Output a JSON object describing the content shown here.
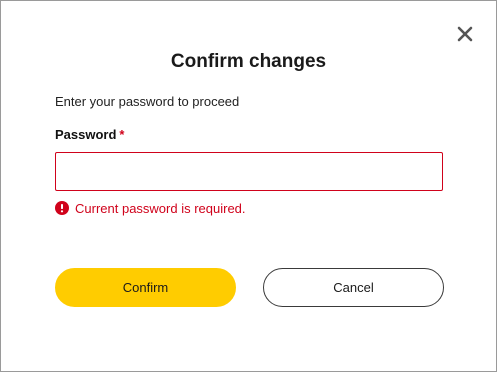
{
  "dialog": {
    "title": "Confirm changes",
    "subtitle": "Enter your password to proceed",
    "close_icon": "close-icon"
  },
  "password_field": {
    "label": "Password",
    "required_marker": "*",
    "value": "",
    "placeholder": "",
    "error_message": "Current password is required.",
    "error_icon": "error-circle-icon"
  },
  "buttons": {
    "confirm_label": "Confirm",
    "cancel_label": "Cancel"
  },
  "colors": {
    "accent": "#ffcc00",
    "error": "#d0021b"
  }
}
